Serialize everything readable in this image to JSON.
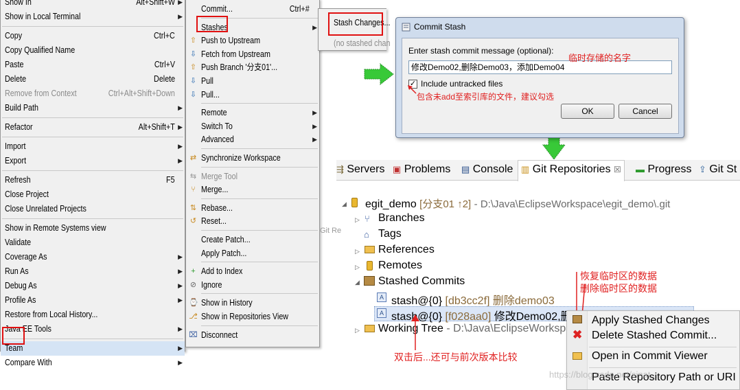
{
  "menu1": {
    "items": [
      {
        "label": "Show In",
        "shortcut": "Alt+Shift+W",
        "arrow": true
      },
      {
        "label": "Show in Local Terminal",
        "shortcut": "",
        "arrow": true
      },
      {
        "label": "Copy",
        "shortcut": "Ctrl+C"
      },
      {
        "label": "Copy Qualified Name",
        "shortcut": ""
      },
      {
        "label": "Paste",
        "shortcut": "Ctrl+V"
      },
      {
        "label": "Delete",
        "shortcut": "Delete"
      },
      {
        "label": "Remove from Context",
        "shortcut": "Ctrl+Alt+Shift+Down",
        "disabled": true
      },
      {
        "label": "Build Path",
        "shortcut": "",
        "arrow": true
      },
      {
        "label": "Refactor",
        "shortcut": "Alt+Shift+T",
        "arrow": true
      },
      {
        "label": "Import",
        "shortcut": "",
        "arrow": true
      },
      {
        "label": "Export",
        "shortcut": "",
        "arrow": true
      },
      {
        "label": "Refresh",
        "shortcut": "F5"
      },
      {
        "label": "Close Project",
        "shortcut": ""
      },
      {
        "label": "Close Unrelated Projects",
        "shortcut": ""
      },
      {
        "label": "Show in Remote Systems view",
        "shortcut": ""
      },
      {
        "label": "Validate",
        "shortcut": ""
      },
      {
        "label": "Coverage As",
        "shortcut": "",
        "arrow": true
      },
      {
        "label": "Run As",
        "shortcut": "",
        "arrow": true
      },
      {
        "label": "Debug As",
        "shortcut": "",
        "arrow": true
      },
      {
        "label": "Profile As",
        "shortcut": "",
        "arrow": true
      },
      {
        "label": "Restore from Local History...",
        "shortcut": ""
      },
      {
        "label": "Java EE Tools",
        "shortcut": "",
        "arrow": true
      },
      {
        "label": "Team",
        "shortcut": "",
        "arrow": true,
        "selected": true
      },
      {
        "label": "Compare With",
        "shortcut": "",
        "arrow": true
      }
    ]
  },
  "menu2": {
    "items": [
      {
        "label": "Commit...",
        "shortcut": "Ctrl+#"
      },
      {
        "label": "Stashes",
        "arrow": true,
        "selected": true
      },
      {
        "label": "Push to Upstream"
      },
      {
        "label": "Fetch from Upstream"
      },
      {
        "label": "Push Branch '分支01'..."
      },
      {
        "label": "Pull"
      },
      {
        "label": "Pull..."
      },
      {
        "label": "Remote",
        "arrow": true
      },
      {
        "label": "Switch To",
        "arrow": true
      },
      {
        "label": "Advanced",
        "arrow": true
      },
      {
        "label": "Synchronize Workspace"
      },
      {
        "label": "Merge Tool",
        "disabled": true
      },
      {
        "label": "Merge..."
      },
      {
        "label": "Rebase..."
      },
      {
        "label": "Reset..."
      },
      {
        "label": "Create Patch..."
      },
      {
        "label": "Apply Patch..."
      },
      {
        "label": "Add to Index"
      },
      {
        "label": "Ignore"
      },
      {
        "label": "Show in History"
      },
      {
        "label": "Show in Repositories View"
      },
      {
        "label": "Disconnect"
      }
    ]
  },
  "menu3": {
    "stash_changes": "Stash Changes...",
    "no_stashed": "(no stashed chan"
  },
  "dialog": {
    "title": "Commit Stash",
    "prompt": "Enter stash commit message (optional):",
    "message_value": "修改Demo02,删除Demo03，添加Demo04",
    "include_untracked": "Include untracked files",
    "ok": "OK",
    "cancel": "Cancel"
  },
  "annotations": {
    "stash_name": "临时存储的名字",
    "include_hint": "包含未add至索引库的文件，建议勾选",
    "apply_hint": "恢复临时区的数据",
    "delete_hint": "删除临时区的数据",
    "double_click_hint": "双击后...还可与前次版本比较"
  },
  "tabs": {
    "servers": "Servers",
    "problems": "Problems",
    "console": "Console",
    "git_repositories": "Git Repositories",
    "close": "☒",
    "progress": "Progress",
    "git_staging": "Git St"
  },
  "tree": {
    "repo_name": "egit_demo",
    "repo_branch": "[分支01 ↑2]",
    "repo_path": "- D:\\Java\\EclipseWorkspace\\egit_demo\\.git",
    "branches": "Branches",
    "tags": "Tags",
    "references": "References",
    "remotes": "Remotes",
    "stashed_commits": "Stashed Commits",
    "stash0_name": "stash@{0}",
    "stash0_id": "[db3cc2f]",
    "stash0_msg": "删除demo03",
    "stash1_name": "stash@{0}",
    "stash1_id": "[f028aa0]",
    "stash1_msg": "修改Demo02,删",
    "working_tree": "Working Tree",
    "working_tree_path": "- D:\\Java\\EclipseWorksp",
    "git_re_partial": "Git Re"
  },
  "context_menu": {
    "apply": "Apply Stashed Changes",
    "delete": "Delete Stashed Commit...",
    "open": "Open in Commit Viewer",
    "paste": "Paste Repository Path or URI"
  },
  "watermark": "https://blog.csdn.net/sinat_..."
}
